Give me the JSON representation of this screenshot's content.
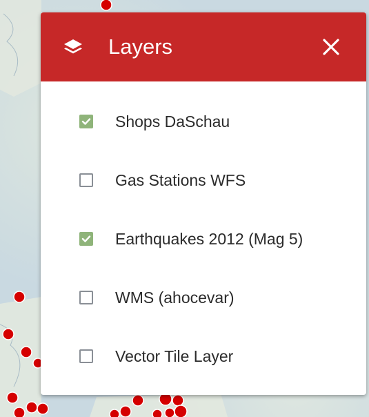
{
  "panel": {
    "title": "Layers",
    "header_color": "#c62828",
    "icons": {
      "header": "layers-icon",
      "close": "close-icon"
    }
  },
  "layers": [
    {
      "label": "Shops DaSchau",
      "checked": true
    },
    {
      "label": "Gas Stations WFS",
      "checked": false
    },
    {
      "label": "Earthquakes 2012 (Mag 5)",
      "checked": true
    },
    {
      "label": "WMS (ahocevar)",
      "checked": false
    },
    {
      "label": "Vector Tile Layer",
      "checked": false
    }
  ],
  "colors": {
    "checkbox_checked": "#8fb47a",
    "marker": "#d50000"
  }
}
